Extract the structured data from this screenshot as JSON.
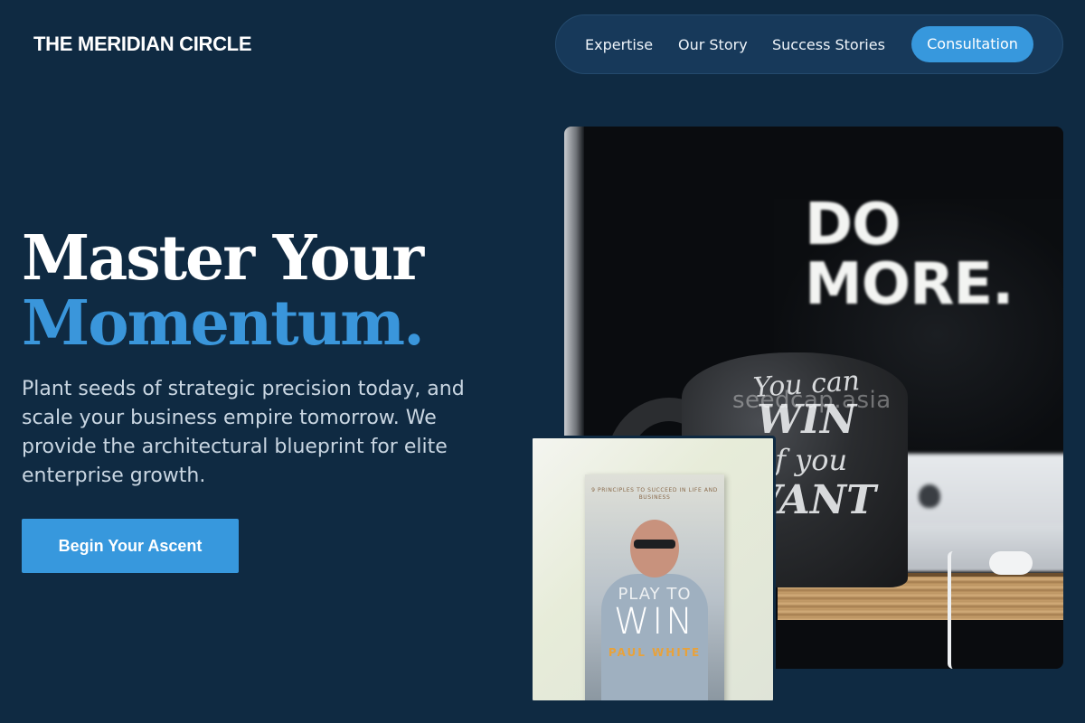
{
  "brand": {
    "name": "THE MERIDIAN CIRCLE"
  },
  "nav": {
    "links": [
      "Expertise",
      "Our Story",
      "Success Stories"
    ],
    "cta_label": "Consultation"
  },
  "hero": {
    "title_line1": "Master Your",
    "title_line2": "Momentum.",
    "subtitle": "Plant seeds of strategic precision today, and scale your business empire tomorrow. We provide the architectural blueprint for elite enterprise growth.",
    "cta_label": "Begin Your Ascent"
  },
  "images": {
    "main": {
      "sign_text": "DO MORE.",
      "mug_lines": [
        "You can",
        "WIN",
        "if you",
        "WANT"
      ],
      "watermark": "seedcap.asia"
    },
    "book": {
      "tagline": "9 PRINCIPLES TO SUCCEED IN LIFE AND BUSINESS",
      "title_top": "PLAY TO",
      "title_main": "WIN",
      "author": "PAUL WHITE"
    }
  },
  "colors": {
    "background": "#0f2a42",
    "accent": "#3798dd",
    "nav_pill": "#17395a"
  }
}
